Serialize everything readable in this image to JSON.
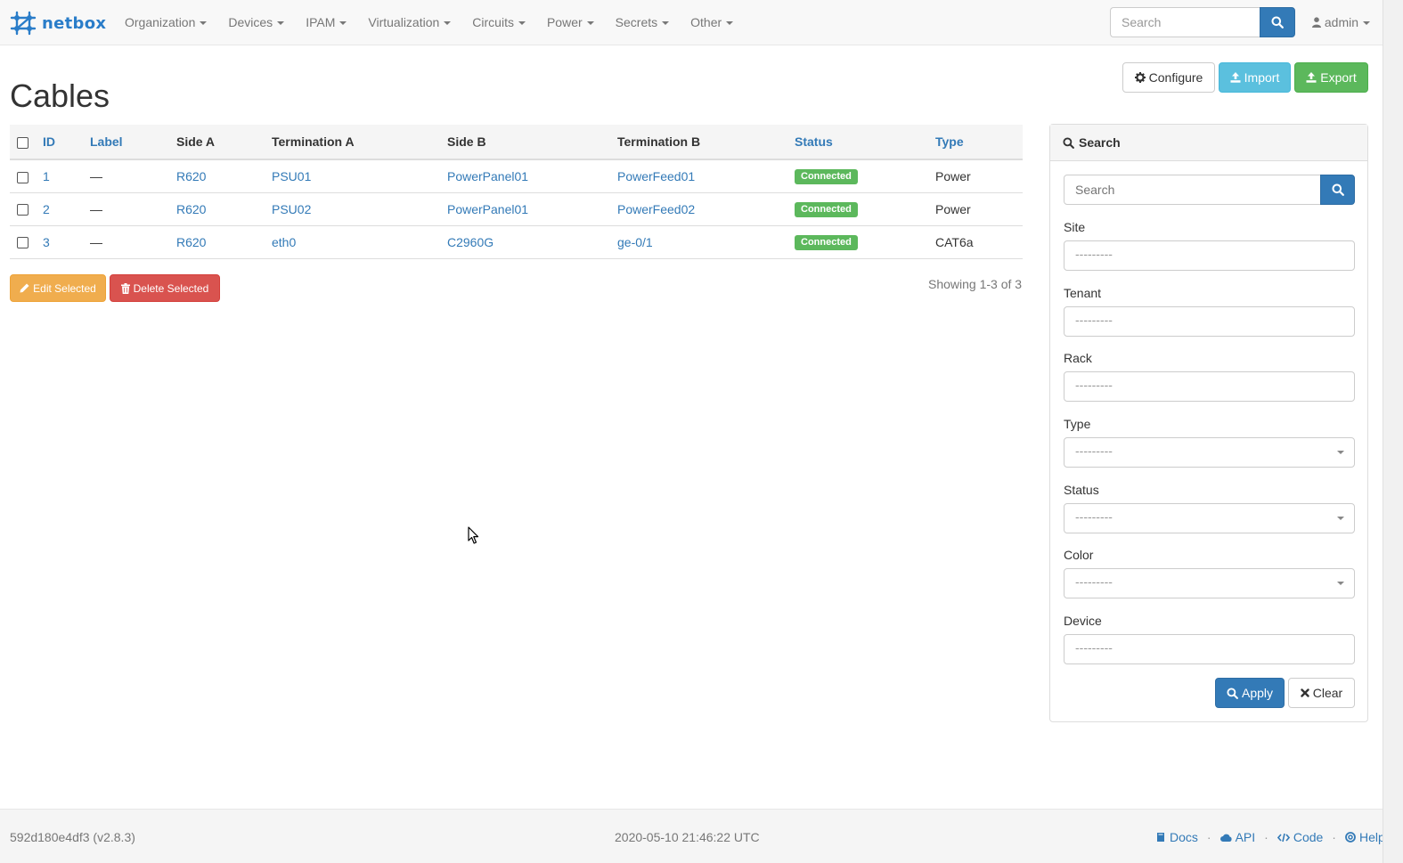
{
  "navbar": {
    "brand": "netbox",
    "menus": [
      "Organization",
      "Devices",
      "IPAM",
      "Virtualization",
      "Circuits",
      "Power",
      "Secrets",
      "Other"
    ],
    "search_placeholder": "Search",
    "user": "admin"
  },
  "page": {
    "title": "Cables",
    "buttons": {
      "configure": "Configure",
      "import": "Import",
      "export": "Export"
    }
  },
  "table": {
    "columns": [
      "ID",
      "Label",
      "Side A",
      "Termination A",
      "Side B",
      "Termination B",
      "Status",
      "Type"
    ],
    "rows": [
      {
        "id": "1",
        "label": "—",
        "side_a": "R620",
        "termination_a": "PSU01",
        "side_b": "PowerPanel01",
        "termination_b": "PowerFeed01",
        "status": "Connected",
        "type": "Power"
      },
      {
        "id": "2",
        "label": "—",
        "side_a": "R620",
        "termination_a": "PSU02",
        "side_b": "PowerPanel01",
        "termination_b": "PowerFeed02",
        "status": "Connected",
        "type": "Power"
      },
      {
        "id": "3",
        "label": "—",
        "side_a": "R620",
        "termination_a": "eth0",
        "side_b": "C2960G",
        "termination_b": "ge-0/1",
        "status": "Connected",
        "type": "CAT6a"
      }
    ],
    "edit_selected": "Edit Selected",
    "delete_selected": "Delete Selected",
    "showing": "Showing 1-3 of 3"
  },
  "filter": {
    "title": "Search",
    "q_placeholder": "Search",
    "fields": {
      "site": {
        "label": "Site",
        "value": "---------"
      },
      "tenant": {
        "label": "Tenant",
        "value": "---------"
      },
      "rack": {
        "label": "Rack",
        "value": "---------"
      },
      "type": {
        "label": "Type",
        "value": "---------"
      },
      "status": {
        "label": "Status",
        "value": "---------"
      },
      "color": {
        "label": "Color",
        "value": "---------"
      },
      "device": {
        "label": "Device",
        "value": "---------"
      }
    },
    "apply": "Apply",
    "clear": "Clear"
  },
  "footer": {
    "version": "592d180e4df3 (v2.8.3)",
    "timestamp": "2020-05-10 21:46:22 UTC",
    "links": {
      "docs": "Docs",
      "api": "API",
      "code": "Code",
      "help": "Help"
    }
  },
  "colors": {
    "primary": "#337ab7",
    "success": "#5cb85c",
    "info": "#5bc0de",
    "warning": "#f0ad4e",
    "danger": "#d9534f"
  }
}
